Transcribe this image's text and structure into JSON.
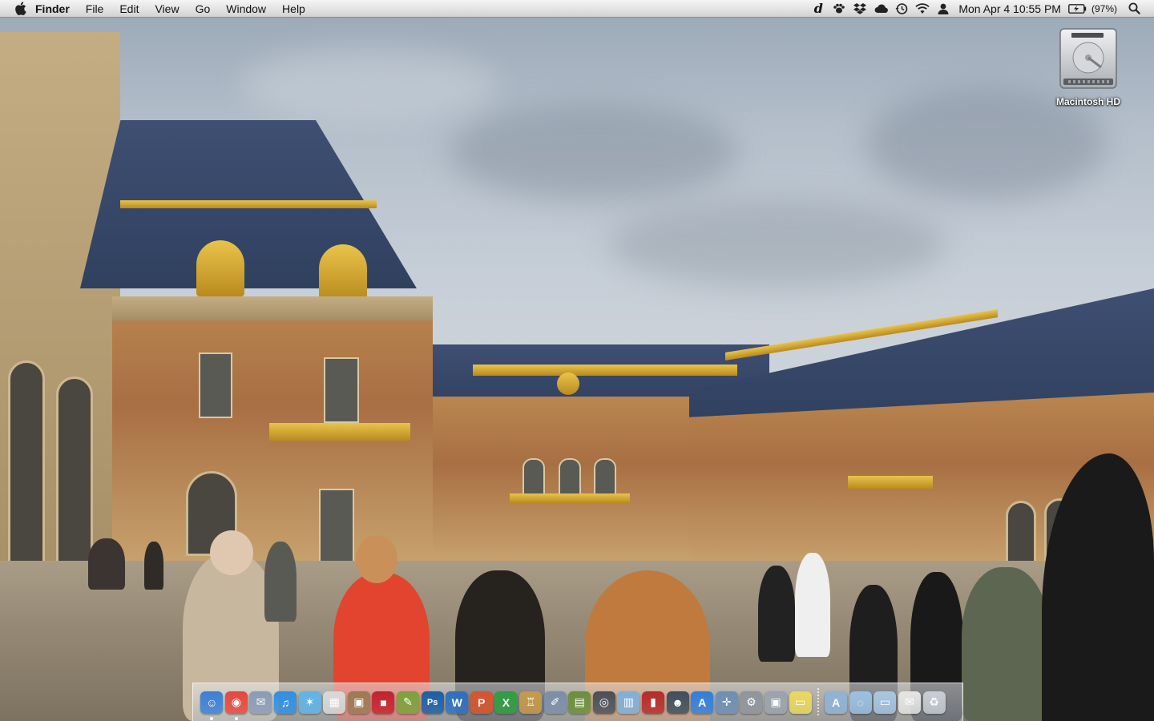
{
  "menubar": {
    "app_name": "Finder",
    "menus": [
      "File",
      "Edit",
      "View",
      "Go",
      "Window",
      "Help"
    ],
    "status": {
      "datetime": "Mon Apr 4  10:55 PM",
      "battery_percent": "(97%)"
    }
  },
  "desktop": {
    "icons": [
      {
        "label": "Macintosh HD",
        "icon": "hard-drive-icon"
      }
    ]
  },
  "dock": {
    "apps": [
      {
        "name": "finder",
        "icon": "finder-icon",
        "running": true,
        "color": "#3a7fd6",
        "glyph": "☺"
      },
      {
        "name": "chrome",
        "icon": "chrome-icon",
        "running": true,
        "color": "#e8453c",
        "glyph": "◉"
      },
      {
        "name": "mail",
        "icon": "mail-stamp-icon",
        "running": false,
        "color": "#8a9bb8",
        "glyph": "✉"
      },
      {
        "name": "itunes",
        "icon": "itunes-icon",
        "running": false,
        "color": "#2f8fe3",
        "glyph": "♫"
      },
      {
        "name": "network-utility",
        "icon": "xcode-icon",
        "running": false,
        "color": "#5fb4e8",
        "glyph": "✶"
      },
      {
        "name": "calendar",
        "icon": "calendar-icon",
        "running": false,
        "color": "#d9d9d9",
        "glyph": "▦"
      },
      {
        "name": "iphoto",
        "icon": "iphoto-icon",
        "running": false,
        "color": "#9c7a52",
        "glyph": "▣"
      },
      {
        "name": "photo-booth",
        "icon": "photo-booth-icon",
        "running": false,
        "color": "#c4222d",
        "glyph": "■"
      },
      {
        "name": "textmate",
        "icon": "brush-icon",
        "running": false,
        "color": "#7aa33a",
        "glyph": "✎"
      },
      {
        "name": "photoshop",
        "icon": "photoshop-icon",
        "running": false,
        "color": "#1b5fa6",
        "glyph": "Ps"
      },
      {
        "name": "word",
        "icon": "word-icon",
        "running": false,
        "color": "#2d6fc2",
        "glyph": "W"
      },
      {
        "name": "powerpoint",
        "icon": "powerpoint-icon",
        "running": false,
        "color": "#d9532c",
        "glyph": "P"
      },
      {
        "name": "excel",
        "icon": "excel-icon",
        "running": false,
        "color": "#2f9e3f",
        "glyph": "X"
      },
      {
        "name": "keynote",
        "icon": "keynote-icon",
        "running": false,
        "color": "#c79a4a",
        "glyph": "♖"
      },
      {
        "name": "script-editor",
        "icon": "script-editor-icon",
        "running": false,
        "color": "#7b8ea8",
        "glyph": "✐"
      },
      {
        "name": "grapher",
        "icon": "grapher-icon",
        "running": false,
        "color": "#6a8f3a",
        "glyph": "▤"
      },
      {
        "name": "facetime",
        "icon": "camera-icon",
        "running": false,
        "color": "#4a4f58",
        "glyph": "◎"
      },
      {
        "name": "preview",
        "icon": "preview-icon",
        "running": false,
        "color": "#7fb0d9",
        "glyph": "▥"
      },
      {
        "name": "stacks",
        "icon": "red-stack-icon",
        "running": false,
        "color": "#b52b2b",
        "glyph": "▮"
      },
      {
        "name": "spy",
        "icon": "spy-icon",
        "running": false,
        "color": "#3d4e5c",
        "glyph": "☻"
      },
      {
        "name": "app-store",
        "icon": "app-store-icon",
        "running": false,
        "color": "#2f7fdc",
        "glyph": "A"
      },
      {
        "name": "safari",
        "icon": "compass-icon",
        "running": false,
        "color": "#6c8fb5",
        "glyph": "✛"
      },
      {
        "name": "system-preferences",
        "icon": "gear-icon",
        "running": false,
        "color": "#8f959c",
        "glyph": "⚙"
      },
      {
        "name": "image-capture",
        "icon": "image-capture-icon",
        "running": false,
        "color": "#9aa3ad",
        "glyph": "▣"
      },
      {
        "name": "stickies",
        "icon": "stickies-icon",
        "running": false,
        "color": "#e9d95a",
        "glyph": "▭"
      }
    ],
    "stacks": [
      {
        "name": "applications",
        "icon": "applications-folder-icon",
        "color": "#8fb3d6",
        "glyph": "A"
      },
      {
        "name": "documents",
        "icon": "documents-folder-icon",
        "color": "#9cc1e2",
        "glyph": "◌"
      },
      {
        "name": "downloads",
        "icon": "downloads-folder-icon",
        "color": "#a9c7e3",
        "glyph": "▭"
      },
      {
        "name": "files",
        "icon": "files-stack-icon",
        "color": "#e5e5e5",
        "glyph": "✉"
      },
      {
        "name": "trash",
        "icon": "trash-icon",
        "color": "#c9ced4",
        "glyph": "♻"
      }
    ]
  }
}
